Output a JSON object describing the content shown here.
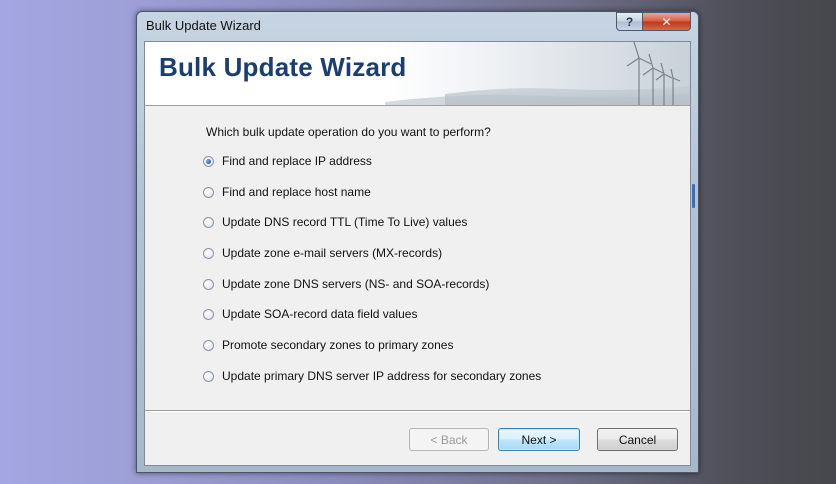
{
  "window": {
    "title": "Bulk Update Wizard",
    "help_label": "?",
    "close_label": "✕"
  },
  "banner": {
    "heading": "Bulk Update Wizard"
  },
  "question": "Which bulk update operation do you want to perform?",
  "options": [
    {
      "label": "Find and replace IP address",
      "checked": true
    },
    {
      "label": "Find and replace host name",
      "checked": false
    },
    {
      "label": "Update DNS record TTL (Time To Live) values",
      "checked": false
    },
    {
      "label": "Update zone e-mail servers (MX-records)",
      "checked": false
    },
    {
      "label": "Update zone DNS servers (NS- and SOA-records)",
      "checked": false
    },
    {
      "label": "Update SOA-record data field values",
      "checked": false
    },
    {
      "label": "Promote secondary zones to primary zones",
      "checked": false
    },
    {
      "label": "Update primary DNS server IP address for secondary zones",
      "checked": false
    }
  ],
  "buttons": {
    "back": "< Back",
    "next": "Next >",
    "cancel": "Cancel"
  },
  "colors": {
    "heading": "#1b3e72",
    "close_button": "#c0381c",
    "default_button_border": "#3c7fb1"
  }
}
